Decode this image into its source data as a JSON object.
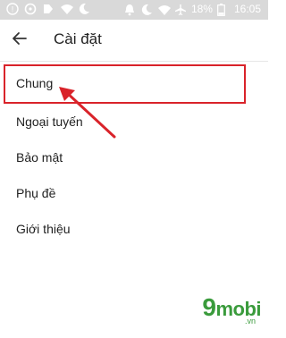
{
  "status_bar": {
    "battery": "18%",
    "time": "16:05",
    "icons_left": [
      "person-icon",
      "sync-icon",
      "tag-icon",
      "wifi-icon",
      "moon-icon"
    ],
    "icons_right": [
      "bell-icon",
      "moon-icon",
      "wifi-icon",
      "airplane-icon",
      "battery-icon"
    ]
  },
  "app_bar": {
    "title": "Cài đặt",
    "back_icon": "arrow-back-icon"
  },
  "menu": {
    "items": [
      {
        "label": "Chung"
      },
      {
        "label": "Ngoại tuyến"
      },
      {
        "label": "Bảo mật"
      },
      {
        "label": "Phụ đề"
      },
      {
        "label": "Giới thiệu"
      }
    ]
  },
  "watermark": {
    "brand": "mobi",
    "digit": "9",
    "domain": ".vn"
  },
  "colors": {
    "status_bar_bg": "#d9d9d9",
    "highlight": "#d9232a",
    "logo": "#3a9b3c"
  }
}
